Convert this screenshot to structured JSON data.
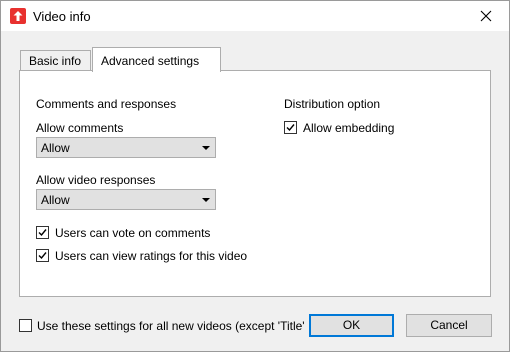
{
  "window": {
    "title": "Video info",
    "close_glyph": "close-icon"
  },
  "tabs": [
    {
      "label": "Basic info",
      "active": false
    },
    {
      "label": "Advanced settings",
      "active": true
    }
  ],
  "comments": {
    "heading": "Comments and responses",
    "allow_comments_label": "Allow comments",
    "allow_comments_value": "Allow",
    "allow_responses_label": "Allow video responses",
    "allow_responses_value": "Allow",
    "vote_label": "Users can vote on comments",
    "vote_checked": true,
    "ratings_label": "Users can view ratings for this video",
    "ratings_checked": true
  },
  "distribution": {
    "heading": "Distribution option",
    "embedding_label": "Allow embedding",
    "embedding_checked": true
  },
  "footer": {
    "use_settings_label": "Use these settings for all new videos (except 'Title'",
    "use_settings_checked": false,
    "ok_label": "OK",
    "cancel_label": "Cancel"
  },
  "colors": {
    "accent": "#0078d7",
    "app_icon": "#e8312f"
  }
}
